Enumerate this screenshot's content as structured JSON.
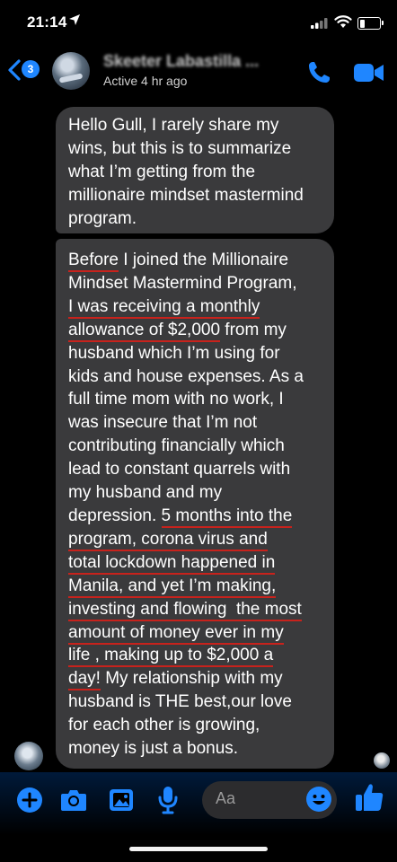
{
  "status_bar": {
    "time": "21:14"
  },
  "header": {
    "back_badge": "3",
    "contact_name": "Skeeter Labastilla ...",
    "active_status": "Active 4 hr ago"
  },
  "messages": {
    "first": [
      "Hello Gull, I rarely share my",
      "wins, but this is to summarize",
      "what I’m getting from the",
      "millionaire mindset mastermind",
      "program."
    ],
    "second": [
      [
        {
          "t": "Before",
          "u": true
        },
        {
          "t": " I joined the Millionaire",
          "u": false
        }
      ],
      [
        {
          "t": "Mindset Mastermind Program,",
          "u": false
        }
      ],
      [
        {
          "t": "I was receiving a monthly",
          "u": true
        }
      ],
      [
        {
          "t": "allowance of $2,000",
          "u": true
        },
        {
          "t": " from my",
          "u": false
        }
      ],
      [
        {
          "t": "husband which I’m using for",
          "u": false
        }
      ],
      [
        {
          "t": "kids and house expenses. As a",
          "u": false
        }
      ],
      [
        {
          "t": "full time mom with no work, I",
          "u": false
        }
      ],
      [
        {
          "t": "was insecure that I’m not",
          "u": false
        }
      ],
      [
        {
          "t": "contributing financially which",
          "u": false
        }
      ],
      [
        {
          "t": "lead to constant quarrels with",
          "u": false
        }
      ],
      [
        {
          "t": "my husband and my",
          "u": false
        }
      ],
      [
        {
          "t": "depression. ",
          "u": false
        },
        {
          "t": "5 months into the",
          "u": true
        }
      ],
      [
        {
          "t": "program, corona virus and",
          "u": true
        }
      ],
      [
        {
          "t": "total lockdown happened in",
          "u": true
        }
      ],
      [
        {
          "t": "Manila, and yet I’m making,",
          "u": true
        }
      ],
      [
        {
          "t": "investing and flowing  the most",
          "u": true
        }
      ],
      [
        {
          "t": "amount of money ever in my",
          "u": true
        }
      ],
      [
        {
          "t": "life , making up to $2,000 a",
          "u": true
        }
      ],
      [
        {
          "t": "day!",
          "u": true
        },
        {
          "t": " My relationship with my",
          "u": false
        }
      ],
      [
        {
          "t": "husband is THE best,our love",
          "u": false
        }
      ],
      [
        {
          "t": "for each other is growing,",
          "u": false
        }
      ],
      [
        {
          "t": "money is just a bonus.",
          "u": false
        }
      ]
    ]
  },
  "composer": {
    "placeholder": "Aa"
  },
  "colors": {
    "accent": "#1f86ff",
    "bubble": "#3a3a3c",
    "underline": "#c8221c"
  },
  "icons": {
    "status": [
      "location-arrow-icon",
      "signal-icon",
      "wifi-icon",
      "battery-icon"
    ],
    "header": [
      "back-chevron-icon",
      "phone-icon",
      "video-camera-icon"
    ],
    "toolbar": [
      "plus-icon",
      "camera-icon",
      "image-icon",
      "microphone-icon",
      "emoji-icon",
      "thumbs-up-icon"
    ]
  }
}
